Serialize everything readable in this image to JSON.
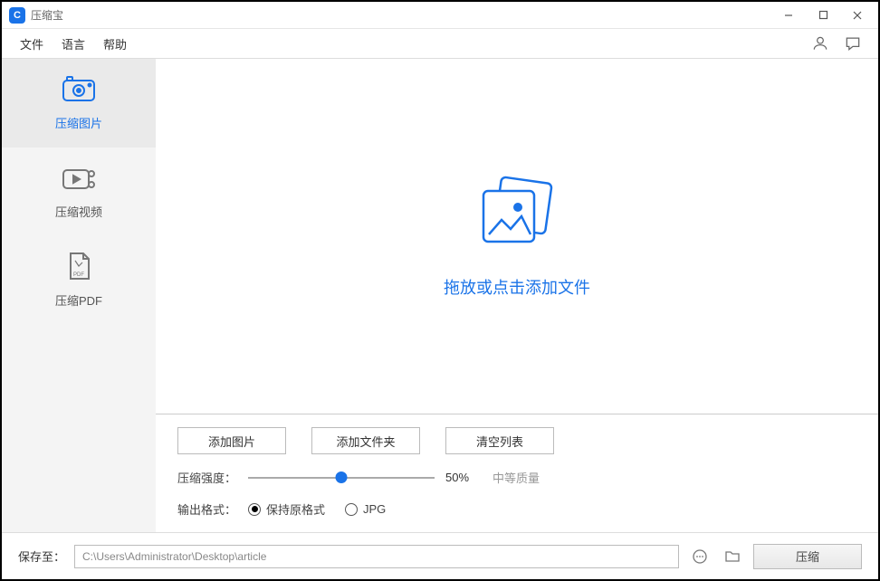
{
  "window": {
    "title": "压缩宝",
    "app_initials": "C"
  },
  "menu": {
    "file": "文件",
    "language": "语言",
    "help": "帮助"
  },
  "sidebar": {
    "items": [
      {
        "label": "压缩图片"
      },
      {
        "label": "压缩视频"
      },
      {
        "label": "压缩PDF"
      }
    ]
  },
  "dropzone": {
    "text": "拖放或点击添加文件"
  },
  "buttons": {
    "add_image": "添加图片",
    "add_folder": "添加文件夹",
    "clear_list": "清空列表"
  },
  "strength": {
    "label": "压缩强度：",
    "percent_text": "50%",
    "percent_value": 50,
    "quality": "中等质量"
  },
  "output_format": {
    "label": "输出格式：",
    "options": {
      "keep": "保持原格式",
      "jpg": "JPG"
    },
    "selected": "keep"
  },
  "footer": {
    "saveto_label": "保存至：",
    "path": "C:\\Users\\Administrator\\Desktop\\article",
    "compress": "压缩"
  }
}
